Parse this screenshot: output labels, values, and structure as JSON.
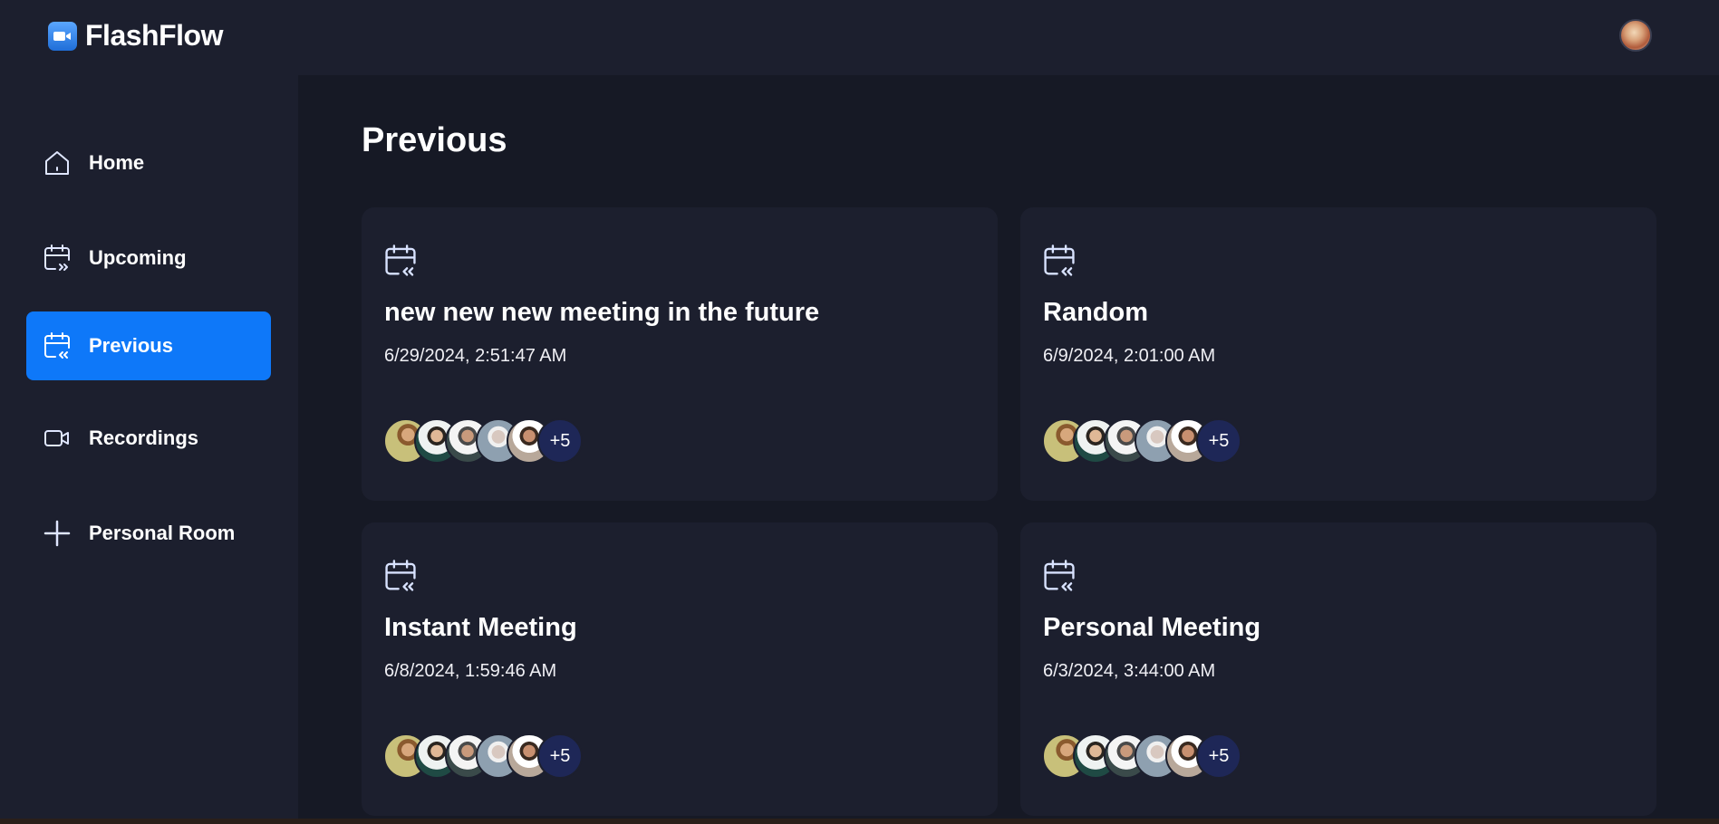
{
  "app": {
    "name": "FlashFlow"
  },
  "sidebar": {
    "items": [
      {
        "label": "Home",
        "icon": "home-icon",
        "active": false
      },
      {
        "label": "Upcoming",
        "icon": "calendar-upcoming-icon",
        "active": false
      },
      {
        "label": "Previous",
        "icon": "calendar-previous-icon",
        "active": true
      },
      {
        "label": "Recordings",
        "icon": "video-icon",
        "active": false
      },
      {
        "label": "Personal Room",
        "icon": "plus-icon",
        "active": false
      }
    ]
  },
  "main": {
    "title": "Previous",
    "meetings": [
      {
        "title": "new new new meeting in the future",
        "date": "6/29/2024, 2:51:47 AM",
        "more_attendees": "+5"
      },
      {
        "title": "Random",
        "date": "6/9/2024, 2:01:00 AM",
        "more_attendees": "+5"
      },
      {
        "title": "Instant Meeting",
        "date": "6/8/2024, 1:59:46 AM",
        "more_attendees": "+5"
      },
      {
        "title": "Personal Meeting",
        "date": "6/3/2024, 3:44:00 AM",
        "more_attendees": "+5"
      }
    ]
  },
  "colors": {
    "background": "#161925",
    "panel": "#1c1f2e",
    "accent": "#0e78f9",
    "more_badge": "#1e2757"
  }
}
